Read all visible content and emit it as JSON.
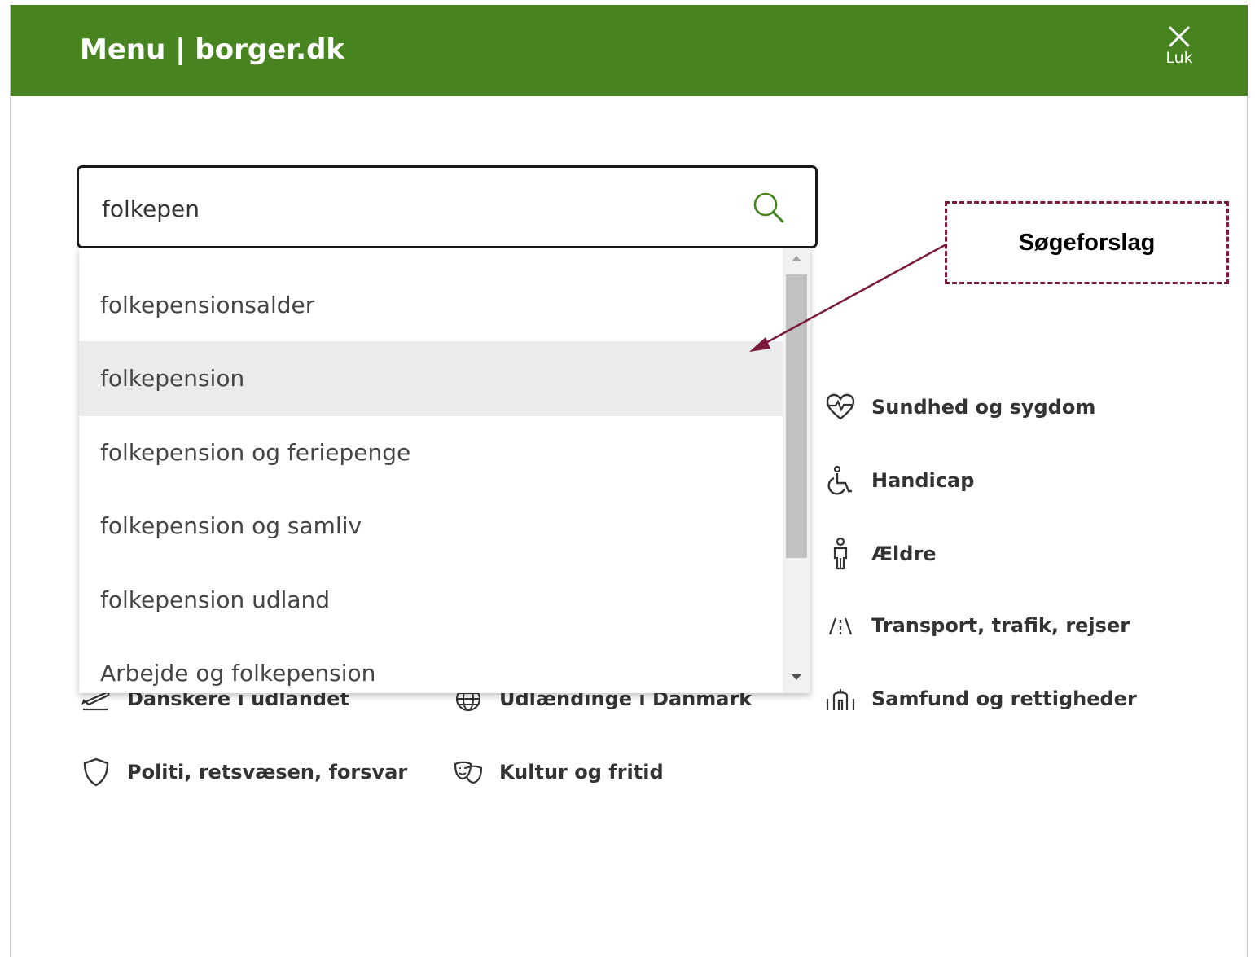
{
  "header": {
    "title": "Menu | borger.dk",
    "close_label": "Luk"
  },
  "search": {
    "value": "folkepen"
  },
  "suggestions": [
    {
      "label": "folkepensionsalder"
    },
    {
      "label": "folkepension",
      "highlighted": true
    },
    {
      "label": "folkepension og feriepenge"
    },
    {
      "label": "folkepension og samliv"
    },
    {
      "label": "folkepension udland"
    },
    {
      "label": "Arbejde og folkepension"
    }
  ],
  "categories": [
    {
      "label": "Sundhed og sygdom",
      "icon": "heart-pulse-icon"
    },
    {
      "label": "Handicap",
      "icon": "wheelchair-icon"
    },
    {
      "label": "Ældre",
      "icon": "elderly-person-icon"
    },
    {
      "label": "Transport, trafik, rejser",
      "icon": "road-icon"
    },
    {
      "label": "Danskere i udlandet",
      "icon": "airplane-departure-icon"
    },
    {
      "label": "Udlændinge i Danmark",
      "icon": "globe-icon"
    },
    {
      "label": "Samfund og rettigheder",
      "icon": "parliament-building-icon"
    },
    {
      "label": "Politi, retsvæsen, forsvar",
      "icon": "shield-icon"
    },
    {
      "label": "Kultur og fritid",
      "icon": "theater-masks-icon"
    }
  ],
  "annotation": {
    "label": "Søgeforslag"
  },
  "colors": {
    "header_bg": "#478420",
    "search_icon": "#478420",
    "annotation": "#7b1a3c"
  }
}
